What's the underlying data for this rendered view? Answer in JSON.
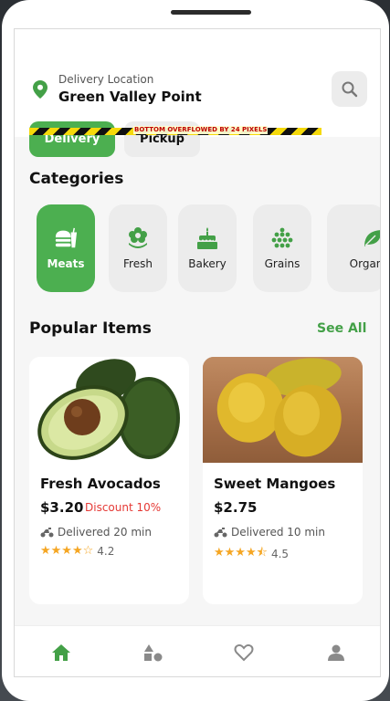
{
  "header": {
    "location_label": "Delivery Location",
    "location_value": "Green Valley Point"
  },
  "mode_tabs": [
    {
      "label": "Delivery",
      "active": true
    },
    {
      "label": "Pickup",
      "active": false
    }
  ],
  "debug_banner": "BOTTOM OVERFLOWED BY 24 PIXELS",
  "categories": {
    "title": "Categories",
    "items": [
      {
        "label": "Meats",
        "icon": "fastfood-icon",
        "active": true
      },
      {
        "label": "Fresh",
        "icon": "flower-icon",
        "active": false
      },
      {
        "label": "Bakery",
        "icon": "cake-icon",
        "active": false
      },
      {
        "label": "Grains",
        "icon": "grain-icon",
        "active": false
      },
      {
        "label": "Organic",
        "icon": "leaf-icon",
        "active": false
      }
    ]
  },
  "popular": {
    "title": "Popular Items",
    "see_all": "See All",
    "items": [
      {
        "name": "Fresh Avocados",
        "price": "$3.20",
        "discount": "Discount 10%",
        "delivery": "Delivered 20 min",
        "rating": "4.2",
        "rating_value": 4.2,
        "image": "avocado-image"
      },
      {
        "name": "Sweet Mangoes",
        "price": "$2.75",
        "discount": "",
        "delivery": "Delivered 10 min",
        "rating": "4.5",
        "rating_value": 4.5,
        "image": "mango-image"
      }
    ]
  },
  "nav": [
    {
      "icon": "home-icon",
      "active": true
    },
    {
      "icon": "category-icon",
      "active": false
    },
    {
      "icon": "heart-icon",
      "active": false
    },
    {
      "icon": "profile-icon",
      "active": false
    }
  ],
  "colors": {
    "accent": "#4caf50",
    "discount": "#e53935",
    "star": "#f5a623",
    "inactive_icon": "#8a8a8a"
  }
}
